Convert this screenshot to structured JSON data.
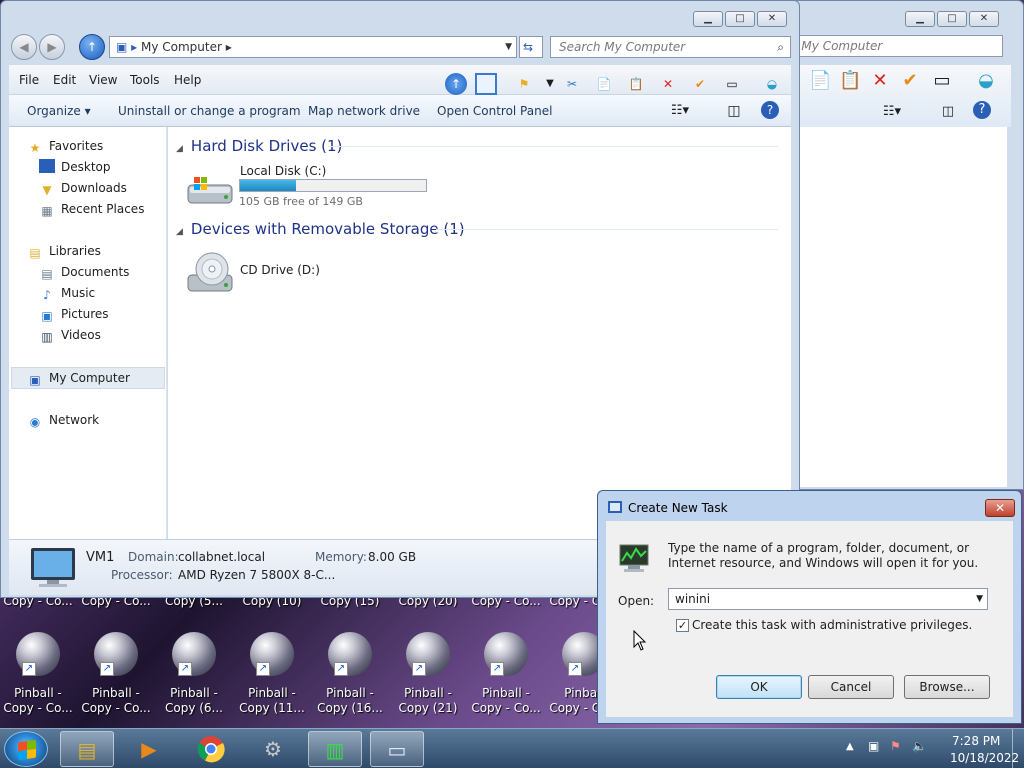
{
  "desktop": {
    "top_labels": [
      "Copy - Co...",
      "Copy - Co...",
      "Copy (5...",
      "Copy (10)",
      "Copy (15)",
      "Copy (20)",
      "Copy - Co...",
      "Copy - Co..."
    ],
    "icons": [
      {
        "line1": "Pinball -",
        "line2": "Copy - Co..."
      },
      {
        "line1": "Pinball -",
        "line2": "Copy - Co..."
      },
      {
        "line1": "Pinball -",
        "line2": "Copy (6..."
      },
      {
        "line1": "Pinball -",
        "line2": "Copy (11..."
      },
      {
        "line1": "Pinball -",
        "line2": "Copy (16..."
      },
      {
        "line1": "Pinball -",
        "line2": "Copy (21)"
      },
      {
        "line1": "Pinball -",
        "line2": "Copy - Co..."
      },
      {
        "line1": "Pinball",
        "line2": "Copy - Co..."
      }
    ]
  },
  "explorer": {
    "address": "My Computer",
    "search_placeholder": "Search My Computer",
    "menu": [
      "File",
      "Edit",
      "View",
      "Tools",
      "Help"
    ],
    "commands": [
      "Organize",
      "Uninstall or change a program",
      "Map network drive",
      "Open Control Panel"
    ],
    "nav": {
      "favorites": "Favorites",
      "favorites_items": [
        "Desktop",
        "Downloads",
        "Recent Places"
      ],
      "libraries": "Libraries",
      "libraries_items": [
        "Documents",
        "Music",
        "Pictures",
        "Videos"
      ],
      "computer": "My Computer",
      "network": "Network"
    },
    "groups": {
      "hdd_header": "Hard Disk Drives (1)",
      "removable_header": "Devices with Removable Storage (1)"
    },
    "drives": {
      "local_name": "Local Disk (C:)",
      "local_free": "105 GB free of 149 GB",
      "local_used_fraction": 0.3,
      "cd_name": "CD Drive (D:)"
    },
    "details": {
      "computer_name": "VM1",
      "domain_label": "Domain:",
      "domain_value": "collabnet.local",
      "memory_label": "Memory:",
      "memory_value": "8.00 GB",
      "processor_label": "Processor:",
      "processor_value": "AMD Ryzen 7 5800X 8-C..."
    }
  },
  "back_window": {
    "search_placeholder": "h My Computer"
  },
  "dialog": {
    "title": "Create New Task",
    "description": "Type the name of a program, folder, document, or Internet resource, and Windows will open it for you.",
    "open_label": "Open:",
    "open_value": "winini",
    "admin_checkbox_label": "Create this task with administrative privileges.",
    "admin_checked": true,
    "ok": "OK",
    "cancel": "Cancel",
    "browse": "Browse..."
  },
  "taskbar": {
    "time": "7:28 PM",
    "date": "10/18/2022"
  },
  "colors": {
    "accent": "#1e3287",
    "disk_bar": "#2a9ad4",
    "taskbar": "#3e5a7a"
  }
}
